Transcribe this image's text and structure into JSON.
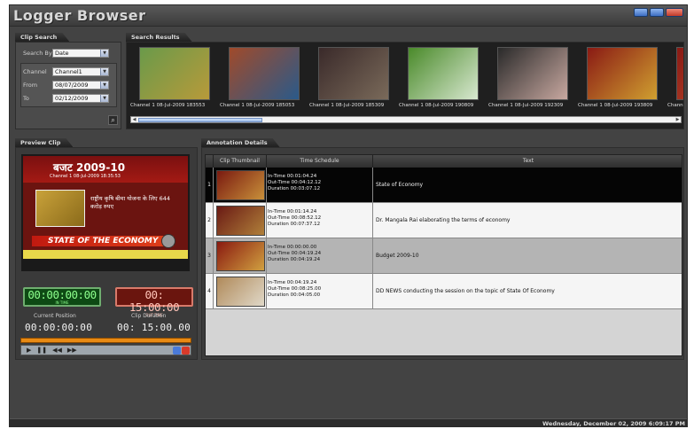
{
  "app": {
    "title": "Logger Browser"
  },
  "clip_search": {
    "tab": "Clip Search",
    "search_by_label": "Search By",
    "search_by_value": "Date",
    "channel_label": "Channel",
    "channel_value": "Channel1",
    "from_label": "From",
    "from_value": "08/07/2009",
    "to_label": "To",
    "to_value": "02/12/2009"
  },
  "search_results": {
    "tab": "Search Results",
    "items": [
      {
        "caption": "Channel 1 08-Jul-2009 183553",
        "colors": [
          "#6a9a4a",
          "#b89a3a"
        ]
      },
      {
        "caption": "Channel 1 08-Jul-2009 185053",
        "colors": [
          "#a04a2a",
          "#2a5a8a"
        ]
      },
      {
        "caption": "Channel 1 08-Jul-2009 185309",
        "colors": [
          "#3a2a2a",
          "#7a6a5a"
        ]
      },
      {
        "caption": "Channel 1 08-Jul-2009 190809",
        "colors": [
          "#4a8a2a",
          "#d8e8d0"
        ]
      },
      {
        "caption": "Channel 1 08-Jul-2009 192309",
        "colors": [
          "#2a2a2a",
          "#c8a8a0"
        ]
      },
      {
        "caption": "Channel 1 08-Jul-2009 193809",
        "colors": [
          "#8a1a14",
          "#d0a030"
        ]
      },
      {
        "caption": "Channe",
        "colors": [
          "#8a1a14",
          "#c05030"
        ]
      }
    ]
  },
  "preview_clip": {
    "tab": "Preview Clip",
    "video": {
      "headline": "बजट 2009-10",
      "subline": "Channel 1 08-Jul-2009 18:35:53",
      "hindi_text": "राष्ट्रीय कृषि बीमा योजना के लिए 644 करोड़ रुपए",
      "band_text": "STATE OF THE ECONOMY"
    },
    "in_time": "00:00:00:00",
    "in_time_label": "IN TIME",
    "out_time": "00: 15:00:00",
    "out_time_label": "OUT TIME",
    "current_position_label": "Current Position",
    "current_position": "00:00:00:00",
    "clip_duration_label": "Clip Duration",
    "clip_duration": "00: 15:00.00",
    "transport_icons": [
      "play-icon",
      "pause-icon",
      "rewind-icon",
      "fast-forward-icon"
    ]
  },
  "annotation_details": {
    "tab": "Annotation Details",
    "columns": [
      "Clip Thumbnail",
      "Time Schedule",
      "Text"
    ],
    "rows": [
      {
        "index": "1",
        "in_time": "In-Time  00:01:04.24",
        "out_time": "Out-Time 00:04:12.12",
        "duration": "Duration  00:03:07.12",
        "text": "State of Economy",
        "colors": [
          "#7a1a10",
          "#c8903a"
        ]
      },
      {
        "index": "2",
        "in_time": "In-Time  00:01:14.24",
        "out_time": "Out-Time 00:08:52.12",
        "duration": "Duration  00:07:37.12",
        "text": "Dr. Mangala Rai elaborating the terms of economy",
        "colors": [
          "#6a1a14",
          "#b0803a"
        ]
      },
      {
        "index": "3",
        "in_time": "In-Time  00:00:00.00",
        "out_time": "Out-Time 00:04:19.24",
        "duration": "Duration  00:04:19.24",
        "text": "Budget 2009-10",
        "colors": [
          "#8a1a10",
          "#d0a040"
        ]
      },
      {
        "index": "4",
        "in_time": "In-Time  00:04:19.24",
        "out_time": "Out-Time 00:08:25.00",
        "duration": "Duration  00:04:05.00",
        "text": "DD NEWS conducting the session on the topic of State Of Economy",
        "colors": [
          "#b08a5a",
          "#e0d8c8"
        ]
      }
    ]
  },
  "status": {
    "datetime": "Wednesday, December 02, 2009 6:09:17 PM"
  }
}
